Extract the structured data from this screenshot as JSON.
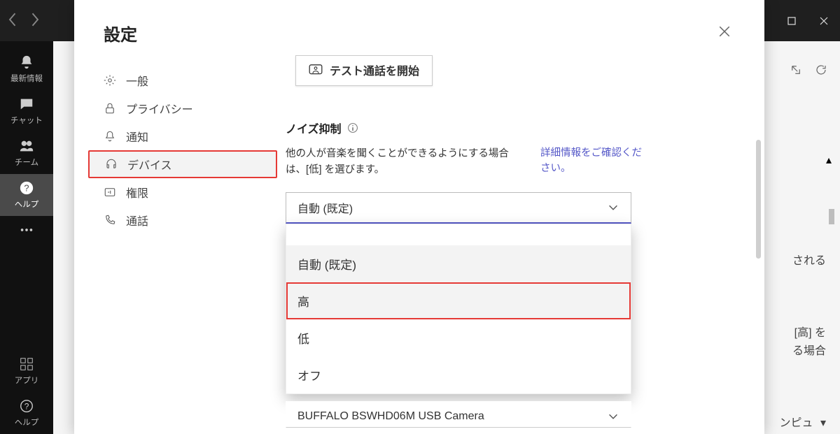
{
  "titlebar": {
    "back_icon": "chevron-left",
    "forward_icon": "chevron-right",
    "window_controls": [
      "minimize",
      "maximize",
      "close"
    ]
  },
  "rail": {
    "items": [
      {
        "icon": "bell",
        "label": "最新情報"
      },
      {
        "icon": "chat",
        "label": "チャット"
      },
      {
        "icon": "people",
        "label": "チーム"
      },
      {
        "icon": "help-filled",
        "label": "ヘルプ",
        "active": true
      },
      {
        "icon": "dots",
        "label": ""
      }
    ],
    "bottom": [
      {
        "icon": "apps",
        "label": "アプリ"
      },
      {
        "icon": "help-outline",
        "label": "ヘルプ"
      }
    ]
  },
  "background": {
    "popout_icon": "popout",
    "refresh_icon": "refresh",
    "text1": "される",
    "text2_line1": "[高] を",
    "text2_line2": "る場合",
    "text3": "ンピュ",
    "arrow_up": "▴",
    "arrow_down": "▾"
  },
  "modal": {
    "title": "設定",
    "nav": [
      {
        "icon": "gear",
        "label": "一般"
      },
      {
        "icon": "lock",
        "label": "プライバシー"
      },
      {
        "icon": "bell",
        "label": "通知"
      },
      {
        "icon": "headset",
        "label": "デバイス",
        "selected": true
      },
      {
        "icon": "permission",
        "label": "権限"
      },
      {
        "icon": "phone",
        "label": "通話"
      }
    ],
    "test_call_button": "テスト通話を開始",
    "section_title": "ノイズ抑制",
    "description": "他の人が音楽を聞くことができるようにする場合は、[低] を選びます。",
    "link": "詳細情報をご確認ください。",
    "noise_select_value": "自動 (既定)",
    "noise_options": [
      "自動 (既定)",
      "高",
      "低",
      "オフ"
    ],
    "camera_select_value": "BUFFALO BSWHD06M USB Camera"
  }
}
